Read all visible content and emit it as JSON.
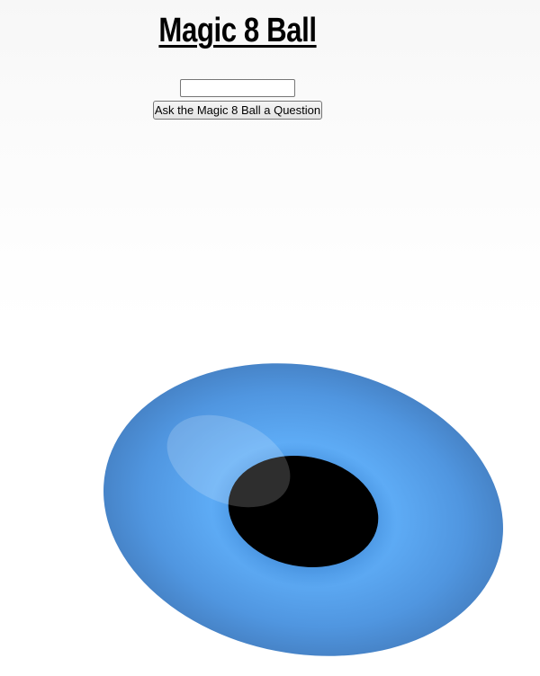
{
  "page": {
    "title": "Magic 8 Ball"
  },
  "question": {
    "value": "",
    "placeholder": ""
  },
  "ask_button": {
    "label": "Ask the Magic 8 Ball a Question"
  },
  "ball": {
    "shell_color": "#5aabf5",
    "shell_edge_color": "#4a8fd0",
    "window_color": "#000000",
    "answer": ""
  }
}
